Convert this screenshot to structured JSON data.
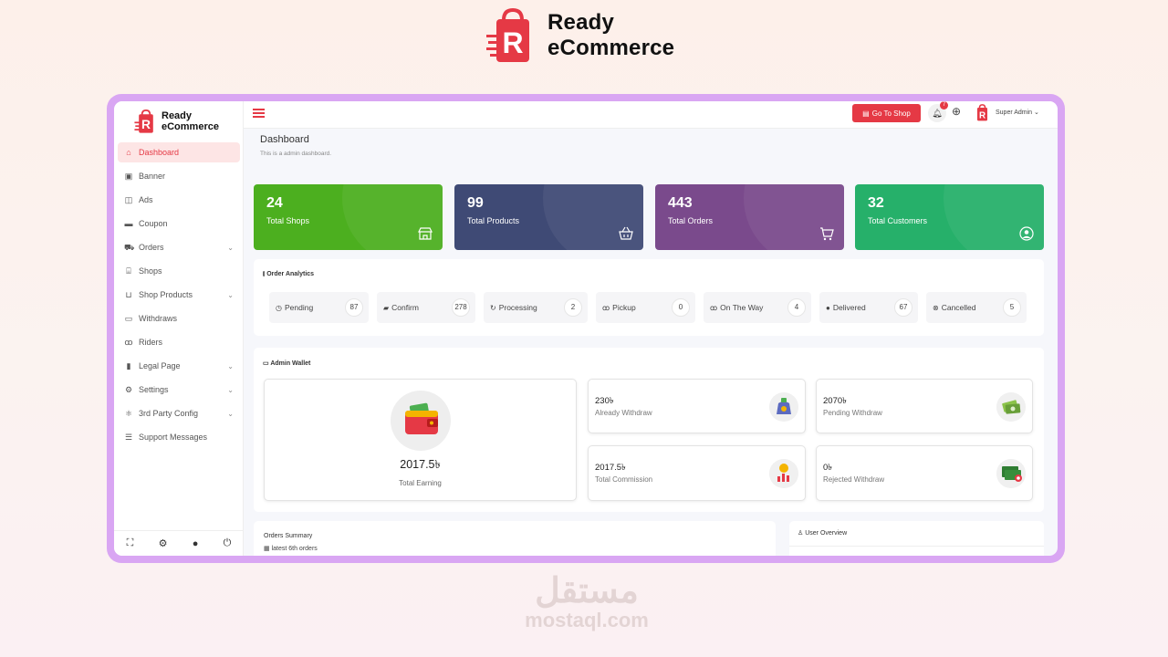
{
  "brand": {
    "line1": "Ready",
    "line2": "eCommerce"
  },
  "sidebar": {
    "logo_line1": "Ready",
    "logo_line2": "eCommerce",
    "items": [
      {
        "label": "Dashboard",
        "icon": "home-icon"
      },
      {
        "label": "Banner",
        "icon": "image-icon"
      },
      {
        "label": "Ads",
        "icon": "images-icon"
      },
      {
        "label": "Coupon",
        "icon": "ticket-icon"
      },
      {
        "label": "Orders",
        "icon": "cart-icon"
      },
      {
        "label": "Shops",
        "icon": "store-icon"
      },
      {
        "label": "Shop Products",
        "icon": "basket-icon"
      },
      {
        "label": "Withdraws",
        "icon": "wallet-icon"
      },
      {
        "label": "Riders",
        "icon": "bike-icon"
      },
      {
        "label": "Legal Page",
        "icon": "bookmark-icon"
      },
      {
        "label": "Settings",
        "icon": "gear-icon"
      },
      {
        "label": "3rd Party Config",
        "icon": "puzzle-icon"
      },
      {
        "label": "Support Messages",
        "icon": "message-icon"
      }
    ],
    "footer_icons": [
      "fullscreen-icon",
      "gear-icon",
      "user-icon",
      "power-icon"
    ]
  },
  "topbar": {
    "go_to_shop": "Go To Shop",
    "notifications": "7",
    "user": "Super Admin"
  },
  "page": {
    "title": "Dashboard",
    "subtitle": "This is a admin dashboard."
  },
  "stats": [
    {
      "value": "24",
      "label": "Total Shops",
      "color": "#4caf1f",
      "icon": "store-icon"
    },
    {
      "value": "99",
      "label": "Total Products",
      "color": "#3f4a75",
      "icon": "basket-icon"
    },
    {
      "value": "443",
      "label": "Total Orders",
      "color": "#7a4a8c",
      "icon": "cart-icon"
    },
    {
      "value": "32",
      "label": "Total Customers",
      "color": "#26b06a",
      "icon": "user-circle-icon"
    }
  ],
  "analytics": {
    "title": "Order Analytics",
    "items": [
      {
        "label": "Pending",
        "count": "87",
        "icon": "clock-icon"
      },
      {
        "label": "Confirm",
        "count": "278",
        "icon": "bag-icon"
      },
      {
        "label": "Processing",
        "count": "2",
        "icon": "refresh-icon"
      },
      {
        "label": "Pickup",
        "count": "0",
        "icon": "bike-icon"
      },
      {
        "label": "On The Way",
        "count": "4",
        "icon": "bike-icon"
      },
      {
        "label": "Delivered",
        "count": "67",
        "icon": "check-circle-icon"
      },
      {
        "label": "Cancelled",
        "count": "5",
        "icon": "x-circle-icon"
      }
    ]
  },
  "wallet": {
    "title": "Admin Wallet",
    "total_value": "2017.5৳",
    "total_label": "Total Earning",
    "boxes": [
      {
        "value": "230৳",
        "label": "Already Withdraw",
        "icon": "money-bag-icon"
      },
      {
        "value": "2070৳",
        "label": "Pending Withdraw",
        "icon": "cash-icon"
      },
      {
        "value": "2017.5৳",
        "label": "Total Commission",
        "icon": "coin-chart-icon"
      },
      {
        "value": "0৳",
        "label": "Rejected Withdraw",
        "icon": "rejected-cash-icon"
      }
    ]
  },
  "orders_summary": {
    "title": "Orders Summary",
    "subtitle": "latest 6th orders"
  },
  "user_overview": {
    "title": "User Overview"
  },
  "watermark": {
    "arabic": "مستقل",
    "site": "mostaql.com"
  },
  "colors": {
    "accent": "#e53945",
    "frame": "#d9a6f3"
  }
}
